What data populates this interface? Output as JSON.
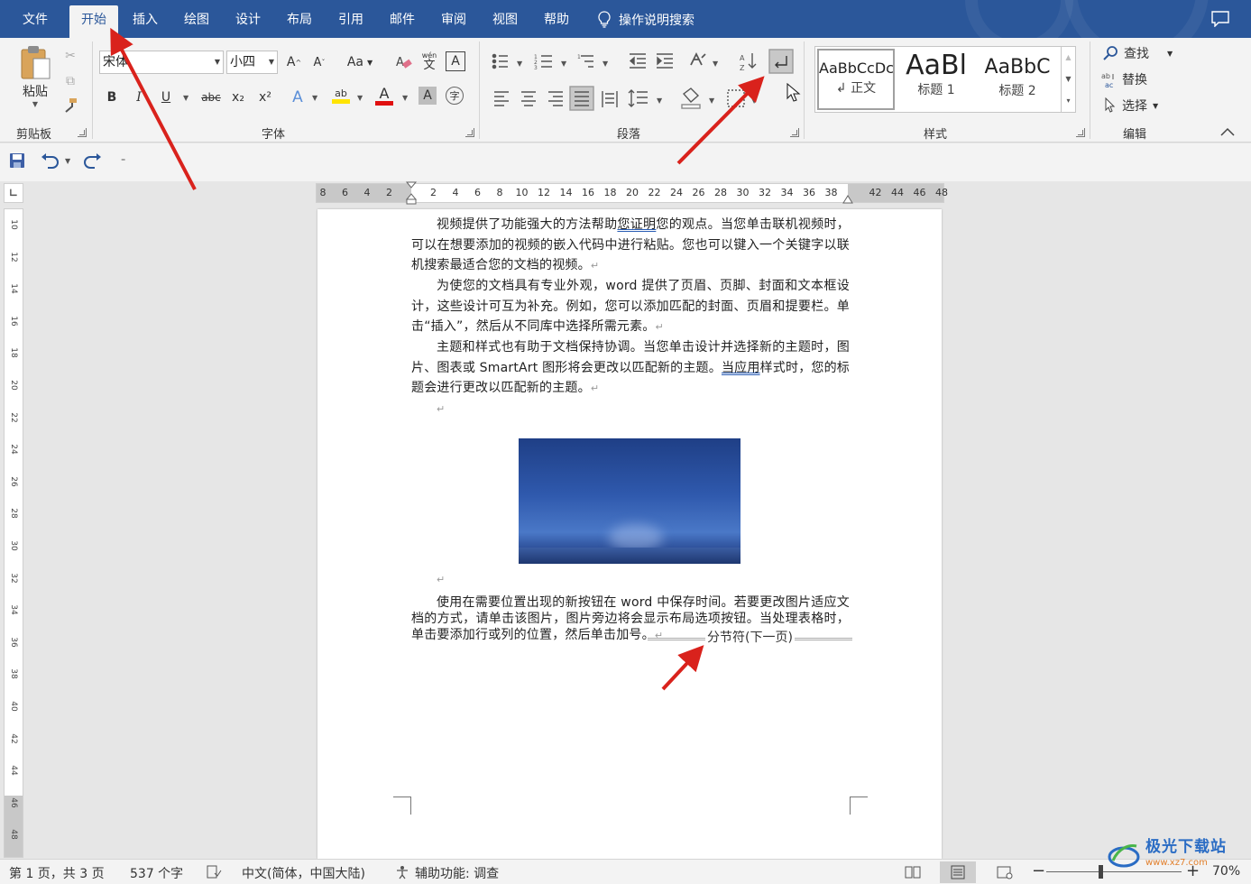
{
  "tabs": [
    {
      "label": "文件",
      "active": false
    },
    {
      "label": "开始",
      "active": true
    },
    {
      "label": "插入",
      "active": false
    },
    {
      "label": "绘图",
      "active": false
    },
    {
      "label": "设计",
      "active": false
    },
    {
      "label": "布局",
      "active": false
    },
    {
      "label": "引用",
      "active": false
    },
    {
      "label": "邮件",
      "active": false
    },
    {
      "label": "审阅",
      "active": false
    },
    {
      "label": "视图",
      "active": false
    },
    {
      "label": "帮助",
      "active": false
    }
  ],
  "tell_me": "操作说明搜索",
  "ribbon": {
    "clipboard": {
      "paste_label": "粘贴",
      "group_label": "剪贴板"
    },
    "font": {
      "group_label": "字体",
      "font_name": "宋体",
      "font_size": "小四",
      "grow_label": "A",
      "shrink_label": "A",
      "case_label": "Aa",
      "phonetic_label": "wén",
      "border_char_label": "A",
      "bold_label": "B",
      "italic_label": "I",
      "underline_label": "U",
      "strike_label": "abc",
      "subscript_label": "x₂",
      "superscript_label": "x²",
      "effects_label": "A",
      "highlight_label": "ab",
      "color_label": "A",
      "shade_label": "A",
      "enclose_label": "字"
    },
    "paragraph": {
      "group_label": "段落"
    },
    "styles": {
      "group_label": "样式",
      "items": [
        {
          "sample": "AaBbCcDc",
          "name": "↲ 正文"
        },
        {
          "sample": "AaBl",
          "name": "标题 1"
        },
        {
          "sample": "AaBbC",
          "name": "标题 2"
        }
      ]
    },
    "editing": {
      "group_label": "编辑",
      "find_label": "查找",
      "replace_label": "替换",
      "select_label": "选择"
    }
  },
  "ruler": {
    "h_left": [
      "8",
      "6",
      "4",
      "2"
    ],
    "h_main": [
      "2",
      "4",
      "6",
      "8",
      "10",
      "12",
      "14",
      "16",
      "18",
      "20",
      "22",
      "24",
      "26",
      "28",
      "30",
      "32",
      "34",
      "36",
      "38"
    ],
    "h_right": [
      "42",
      "44",
      "46",
      "48"
    ],
    "v_ticks": [
      "10",
      "12",
      "14",
      "16",
      "18",
      "20",
      "22",
      "24",
      "26",
      "28",
      "30",
      "32",
      "34",
      "36",
      "38",
      "40",
      "42",
      "44",
      "46",
      "48"
    ]
  },
  "document": {
    "p1_a": "视频提供了功能强大的方法帮助",
    "p1_b": "您证明",
    "p1_c": "您的观点。当您单击联机视频时，可以在想要添加的视频的嵌入代码中进行粘贴。您也可以键入一个关键字以联机搜索最适合您的文档的视频。",
    "p2": "为使您的文档具有专业外观，word 提供了页眉、页脚、封面和文本框设计，这些设计可互为补充。例如，您可以添加匹配的封面、页眉和提要栏。单击“插入”，然后从不同库中选择所需元素。",
    "p3_a": "主题和样式也有助于文档保持协调。当您单击设计并选择新的主题时，图片、图表或 SmartArt 图形将会更改以匹配新的主题。",
    "p3_b": "当应用",
    "p3_c": "样式时，您的标题会进行更改以匹配新的主题。",
    "p4": "使用在需要位置出现的新按钮在 word 中保存时间。若要更改图片适应文档的方式，请单击该图片，图片旁边将会显示布局选项按钮。当处理表格时，单击要添加行或列的位置，然后单击加号。",
    "section_break": "分节符(下一页)",
    "para_mark": "↵"
  },
  "status": {
    "page": "第 1 页，共 3 页",
    "words": "537 个字",
    "language": "中文(简体，中国大陆)",
    "accessibility": "辅助功能: 调查",
    "zoom": "70%",
    "zoom_level": 0.4
  },
  "watermark": {
    "text": "极光下载站",
    "url": "www.xz7.com"
  },
  "colors": {
    "accent": "#2b579a",
    "arrow": "#d9221c"
  }
}
